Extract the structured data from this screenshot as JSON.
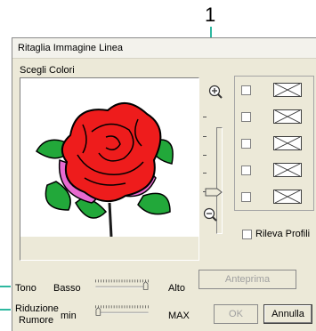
{
  "callout": {
    "number": "1"
  },
  "window": {
    "title": "Ritaglia Immagine Linea"
  },
  "colors_group": {
    "label": "Scegli Colori"
  },
  "color_rows": [
    {
      "checked": false
    },
    {
      "checked": false
    },
    {
      "checked": false
    },
    {
      "checked": false
    },
    {
      "checked": false
    }
  ],
  "rileva": {
    "label": "Rileva Profili",
    "checked": false
  },
  "tono": {
    "label": "Tono",
    "min_label": "Basso",
    "max_label": "Alto",
    "value": 0.95
  },
  "riduzione": {
    "label_line1": "Riduzione",
    "label_line2": "Rumore",
    "min_label": "min",
    "max_label": "MAX",
    "value": 0.05
  },
  "buttons": {
    "preview": "Anteprima",
    "ok": "OK",
    "cancel": "Annulla"
  },
  "zoom": {
    "level": 0.0
  }
}
